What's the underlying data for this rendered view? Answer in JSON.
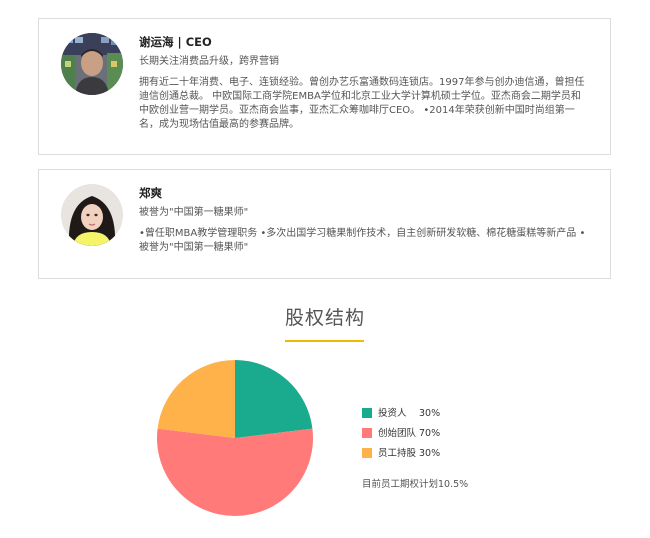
{
  "profiles": [
    {
      "name": "谢运海 | CEO",
      "tagline": "长期关注消费品升级，跨界营销",
      "bio": "拥有近二十年消费、电子、连锁经验。曾创办艺乐富通数码连锁店。1997年参与创办迪信通，曾担任迪信创通总裁。 中欧国际工商学院EMBA学位和北京工业大学计算机硕士学位。亚杰商会二期学员和中欧创业营一期学员。亚杰商会监事，亚杰汇众筹咖啡厅CEO。 •2014年荣获创新中国时尚组第一名，成为现场估值最高的参赛品牌。"
    },
    {
      "name": "郑爽",
      "tagline": "被誉为\"中国第一糖果师\"",
      "bio": "•曾任职MBA教学管理职务 •多次出国学习糖果制作技术，自主创新研发软糖、棉花糖蛋糕等新产品 •被誉为\"中国第一糖果师\""
    }
  ],
  "equity": {
    "title": "股权结构",
    "note": "目前员工期权计划10.5%"
  },
  "chart_data": {
    "type": "pie",
    "series": [
      {
        "name": "投资人",
        "label": "30%",
        "value": 30,
        "color": "#1aaa8e"
      },
      {
        "name": "创始团队",
        "label": "70%",
        "value": 70,
        "color": "#ff7a78"
      },
      {
        "name": "员工持股",
        "label": "30%",
        "value": 30,
        "color": "#ffb24a"
      }
    ],
    "legend": "right"
  },
  "colors": {
    "accent_underline": "#f5b800",
    "card_border": "#dcdcdc"
  }
}
